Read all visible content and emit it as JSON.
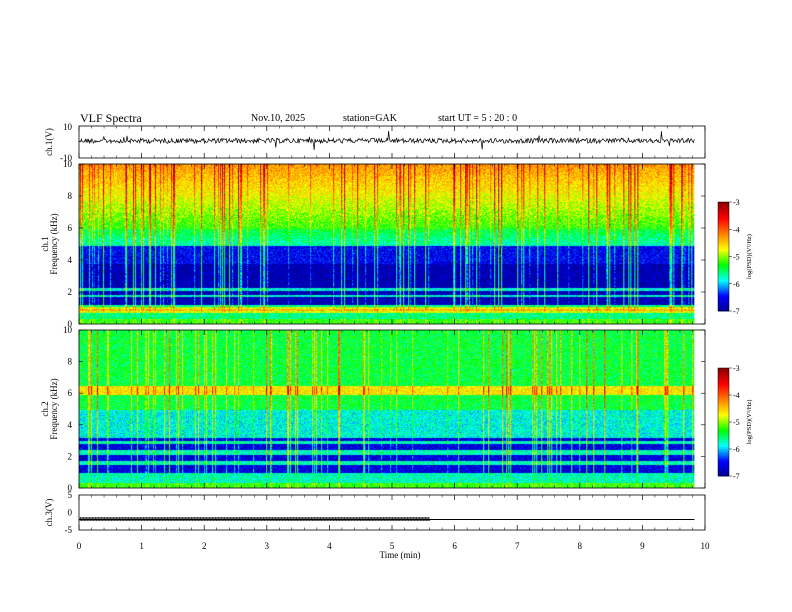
{
  "header": {
    "title": "VLF  Spectra",
    "date": "Nov.10, 2025",
    "station": "station=GAK",
    "start": "start  UT  =   5  : 20 : 0"
  },
  "colors": {
    "colormap": [
      "#00008b",
      "#0000ff",
      "#00ffff",
      "#00ff00",
      "#ffff00",
      "#ff8000",
      "#ff0000",
      "#8b0000"
    ],
    "trace": "#000000"
  },
  "chart_data": [
    {
      "type": "line",
      "name": "ch1-waveform",
      "ylabel": "ch.1(V)",
      "yticks": [
        "10",
        "-10"
      ],
      "ylim": [
        -10,
        10
      ],
      "xlim": [
        0,
        10
      ],
      "description_level": "noise centred near 0 V with occasional spikes"
    },
    {
      "type": "heatmap",
      "name": "ch1-spectrogram",
      "ylabel_top": "ch.1",
      "ylabel": "Frequency (kHz)",
      "yticks": [
        "0",
        "2",
        "4",
        "6",
        "8",
        "10"
      ],
      "ylim": [
        0,
        10
      ],
      "xlim": [
        0,
        9.83
      ],
      "colorbar": {
        "label": "log(PSD)(V²/Hz)",
        "ticks": [
          "-3",
          "-4",
          "-5",
          "-6",
          "-7"
        ],
        "range": [
          -7,
          -3
        ]
      }
    },
    {
      "type": "heatmap",
      "name": "ch2-spectrogram",
      "ylabel_top": "ch.2",
      "ylabel": "Frequency (kHz)",
      "yticks": [
        "0",
        "2",
        "4",
        "6",
        "8",
        "10"
      ],
      "ylim": [
        0,
        10
      ],
      "xlim": [
        0,
        9.83
      ],
      "colorbar": {
        "label": "log(PSD)(V²/Hz)",
        "ticks": [
          "-3",
          "-4",
          "-5",
          "-6",
          "-7"
        ],
        "range": [
          -7,
          -3
        ]
      }
    },
    {
      "type": "line",
      "name": "ch3-level",
      "ylabel": "ch.3(V)",
      "yticks": [
        "5",
        "0",
        "-5"
      ],
      "ylim": [
        -5,
        5
      ],
      "xlim": [
        0,
        10
      ],
      "x": [
        0,
        5.6,
        5.6,
        9.83
      ],
      "y": [
        -2,
        -2,
        -2,
        -2
      ],
      "hatched_until": 5.6
    }
  ],
  "xaxis": {
    "label": "Time  (min)",
    "ticks": [
      "0",
      "1",
      "2",
      "3",
      "4",
      "5",
      "6",
      "7",
      "8",
      "9",
      "10"
    ]
  }
}
